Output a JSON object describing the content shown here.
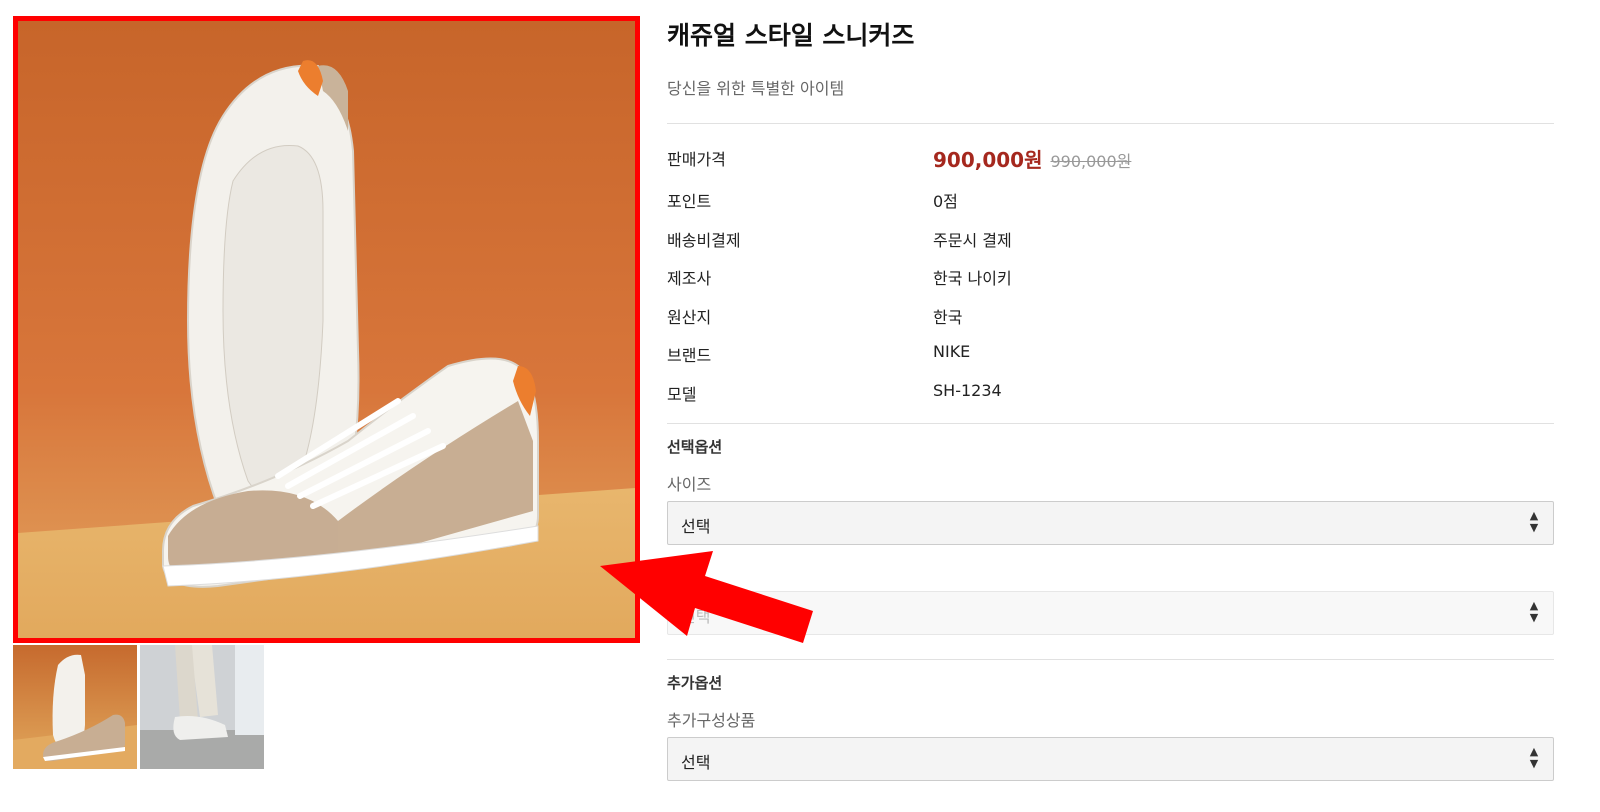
{
  "product": {
    "title": "캐쥬얼 스타일 스니커즈",
    "subtitle": "당신을 위한 특별한 아이템",
    "price_label": "판매가격",
    "price": "900,000원",
    "original_price": "990,000원",
    "details": [
      {
        "label": "포인트",
        "value": "0점"
      },
      {
        "label": "배송비결제",
        "value": "주문시 결제"
      },
      {
        "label": "제조사",
        "value": "한국 나이키"
      },
      {
        "label": "원산지",
        "value": "한국"
      },
      {
        "label": "브랜드",
        "value": "NIKE"
      },
      {
        "label": "모델",
        "value": "SH-1234"
      }
    ]
  },
  "options": {
    "section_title": "선택옵션",
    "size_label": "사이즈",
    "size_value": "선택",
    "second_value": "선택"
  },
  "extra": {
    "section_title": "추가옵션",
    "label": "추가구성상품",
    "value": "선택"
  },
  "colors": {
    "price": "#a5281e",
    "highlight": "#ff0000"
  }
}
